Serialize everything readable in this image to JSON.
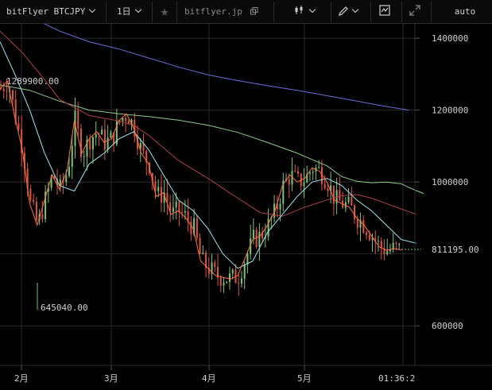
{
  "toolbar": {
    "symbol": "bitFlyer BTCJPY",
    "interval": "1日",
    "source_link": "bitflyer.jp",
    "scale_mode": "auto"
  },
  "icons": {
    "favorite": "star-icon",
    "external": "external-link-icon",
    "chart_type": "candles-icon",
    "draw": "pencil-icon",
    "indicators": "indicator-icon",
    "fullscreen": "expand-icon"
  },
  "colors": {
    "up_candle": "#7cc576",
    "down_candle": "#e0553f",
    "ma_fast": "#ff7043",
    "ma_cyan": "#9be8f0",
    "ma_red": "#b0404a",
    "ma_green": "#8fc98a",
    "ma_blue": "#6a6fd8"
  },
  "price_labels": {
    "high": "1289900.00",
    "low": "645040.00",
    "current": "811195.00"
  },
  "time_readout": "01:36:2",
  "chart_data": {
    "type": "line",
    "title": "",
    "ylim": [
      490000,
      1440000
    ],
    "y_ticks": [
      {
        "value": 1400000,
        "label": "1400000"
      },
      {
        "value": 1200000,
        "label": "1200000"
      },
      {
        "value": 1000000,
        "label": "1000000"
      },
      {
        "value": 600000,
        "label": "600000"
      }
    ],
    "x_ticks": [
      "2月",
      "3月",
      "4月",
      "5月"
    ],
    "series": [
      {
        "color_key": "ma_blue",
        "values": [
          [
            0,
            1520000
          ],
          [
            20,
            1460000
          ],
          [
            40,
            1420000
          ],
          [
            60,
            1390000
          ],
          [
            80,
            1370000
          ],
          [
            100,
            1345000
          ],
          [
            120,
            1320000
          ],
          [
            140,
            1298000
          ],
          [
            160,
            1282000
          ],
          [
            180,
            1268000
          ],
          [
            200,
            1255000
          ],
          [
            220,
            1240000
          ],
          [
            240,
            1225000
          ],
          [
            260,
            1210000
          ],
          [
            275,
            1200000
          ]
        ]
      },
      {
        "color_key": "ma_green",
        "values": [
          [
            0,
            1270000
          ],
          [
            20,
            1255000
          ],
          [
            40,
            1225000
          ],
          [
            60,
            1200000
          ],
          [
            80,
            1190000
          ],
          [
            100,
            1182000
          ],
          [
            120,
            1172000
          ],
          [
            140,
            1158000
          ],
          [
            160,
            1138000
          ],
          [
            180,
            1110000
          ],
          [
            200,
            1080000
          ],
          [
            220,
            1045000
          ],
          [
            230,
            1015000
          ],
          [
            240,
            1002000
          ],
          [
            250,
            998000
          ],
          [
            260,
            1000000
          ],
          [
            270,
            995000
          ],
          [
            275,
            985000
          ],
          [
            280,
            976000
          ],
          [
            285,
            968000
          ]
        ]
      },
      {
        "color_key": "ma_red",
        "values": [
          [
            0,
            1420000
          ],
          [
            15,
            1360000
          ],
          [
            30,
            1285000
          ],
          [
            40,
            1230000
          ],
          [
            60,
            1185000
          ],
          [
            80,
            1170000
          ],
          [
            90,
            1158000
          ],
          [
            100,
            1130000
          ],
          [
            120,
            1060000
          ],
          [
            140,
            1010000
          ],
          [
            160,
            955000
          ],
          [
            175,
            915000
          ],
          [
            190,
            905000
          ],
          [
            205,
            930000
          ],
          [
            220,
            950000
          ],
          [
            230,
            962000
          ],
          [
            240,
            965000
          ],
          [
            250,
            955000
          ],
          [
            260,
            940000
          ],
          [
            270,
            925000
          ],
          [
            280,
            910000
          ]
        ]
      },
      {
        "color_key": "ma_cyan",
        "values": [
          [
            0,
            1390000
          ],
          [
            10,
            1300000
          ],
          [
            20,
            1200000
          ],
          [
            30,
            1080000
          ],
          [
            40,
            990000
          ],
          [
            50,
            975000
          ],
          [
            60,
            1050000
          ],
          [
            70,
            1080000
          ],
          [
            80,
            1120000
          ],
          [
            90,
            1140000
          ],
          [
            100,
            1090000
          ],
          [
            110,
            1020000
          ],
          [
            120,
            950000
          ],
          [
            130,
            920000
          ],
          [
            140,
            870000
          ],
          [
            150,
            800000
          ],
          [
            160,
            760000
          ],
          [
            170,
            780000
          ],
          [
            180,
            860000
          ],
          [
            190,
            910000
          ],
          [
            200,
            960000
          ],
          [
            210,
            1000000
          ],
          [
            220,
            1010000
          ],
          [
            230,
            990000
          ],
          [
            240,
            950000
          ],
          [
            250,
            920000
          ],
          [
            260,
            880000
          ],
          [
            270,
            840000
          ],
          [
            280,
            830000
          ]
        ]
      },
      {
        "color_key": "ma_fast",
        "values": [
          [
            0,
            1260000
          ],
          [
            5,
            1280000
          ],
          [
            10,
            1180000
          ],
          [
            15,
            1090000
          ],
          [
            20,
            940000
          ],
          [
            25,
            880000
          ],
          [
            30,
            950000
          ],
          [
            35,
            1020000
          ],
          [
            40,
            980000
          ],
          [
            45,
            1030000
          ],
          [
            50,
            1170000
          ],
          [
            55,
            1080000
          ],
          [
            60,
            1120000
          ],
          [
            65,
            1140000
          ],
          [
            70,
            1110000
          ],
          [
            75,
            1120000
          ],
          [
            80,
            1170000
          ],
          [
            85,
            1190000
          ],
          [
            90,
            1150000
          ],
          [
            95,
            1080000
          ],
          [
            100,
            1050000
          ],
          [
            105,
            960000
          ],
          [
            110,
            970000
          ],
          [
            115,
            910000
          ],
          [
            120,
            920000
          ],
          [
            125,
            900000
          ],
          [
            130,
            870000
          ],
          [
            135,
            780000
          ],
          [
            140,
            760000
          ],
          [
            145,
            740000
          ],
          [
            150,
            735000
          ],
          [
            155,
            730000
          ],
          [
            160,
            740000
          ],
          [
            165,
            790000
          ],
          [
            170,
            840000
          ],
          [
            175,
            850000
          ],
          [
            180,
            880000
          ],
          [
            185,
            920000
          ],
          [
            190,
            990000
          ],
          [
            195,
            1020000
          ],
          [
            200,
            1000000
          ],
          [
            205,
            1010000
          ],
          [
            210,
            1040000
          ],
          [
            215,
            1030000
          ],
          [
            220,
            1000000
          ],
          [
            225,
            950000
          ],
          [
            230,
            940000
          ],
          [
            235,
            930000
          ],
          [
            240,
            900000
          ],
          [
            245,
            880000
          ],
          [
            250,
            850000
          ],
          [
            255,
            820000
          ],
          [
            260,
            810000
          ],
          [
            265,
            815000
          ],
          [
            270,
            811195
          ]
        ]
      }
    ]
  }
}
